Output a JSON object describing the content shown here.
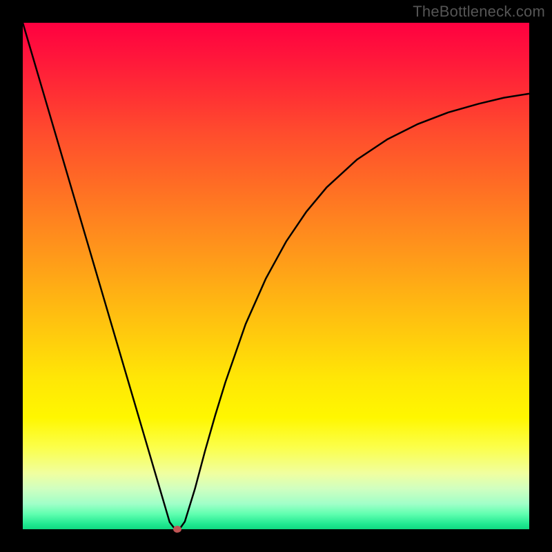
{
  "watermark": "TheBottleneck.com",
  "chart_data": {
    "type": "line",
    "title": "",
    "xlabel": "",
    "ylabel": "",
    "x": [
      0,
      2,
      4,
      6,
      8,
      10,
      12,
      14,
      16,
      18,
      20,
      22,
      24,
      26,
      28,
      29,
      30,
      31,
      32,
      34,
      36,
      38,
      40,
      44,
      48,
      52,
      56,
      60,
      66,
      72,
      78,
      84,
      90,
      95,
      100
    ],
    "y": [
      100,
      93.2,
      86.4,
      79.6,
      72.8,
      66.0,
      59.2,
      52.4,
      45.6,
      38.8,
      32.0,
      25.2,
      18.4,
      11.6,
      4.8,
      1.4,
      0.1,
      0.1,
      1.5,
      8.0,
      15.5,
      22.5,
      29.0,
      40.5,
      49.5,
      56.8,
      62.7,
      67.5,
      73.0,
      77.0,
      80.0,
      82.3,
      84.0,
      85.2,
      86.0
    ],
    "xlim": [
      0,
      100
    ],
    "ylim": [
      0,
      100
    ],
    "gradient": "thermal",
    "marker_point": {
      "x": 30.5,
      "y": 0
    }
  },
  "marker": {
    "color": "#c05555"
  }
}
